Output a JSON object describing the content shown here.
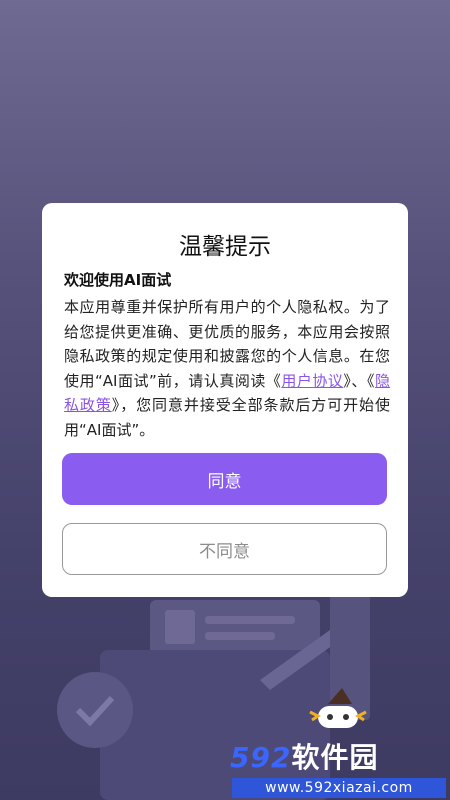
{
  "dialog": {
    "title": "温馨提示",
    "welcome_heading": "欢迎使用AI面试",
    "body_part1": "本应用尊重并保护所有用户的个人隐私权。为了给您提供更准确、更优质的服务，本应用会按照隐私政策的规定使用和披露您的个人信息。在您使用“AI面试”前，请认真阅读《",
    "link_user_agreement": "用户协议",
    "body_part2": "》、《",
    "link_privacy_policy": "隐私政策",
    "body_part3": "》，您同意并接受全部条款后方可开始使用“AI面试”。",
    "agree_label": "同意",
    "disagree_label": "不同意"
  },
  "watermark": {
    "brand_number": "592",
    "brand_text": "软件园",
    "url": "www.592xiazai.com"
  },
  "colors": {
    "accent": "#8b5cf0",
    "link": "#8a55e6",
    "background_top": "#6e6a92",
    "background_bottom": "#3e3b62"
  }
}
